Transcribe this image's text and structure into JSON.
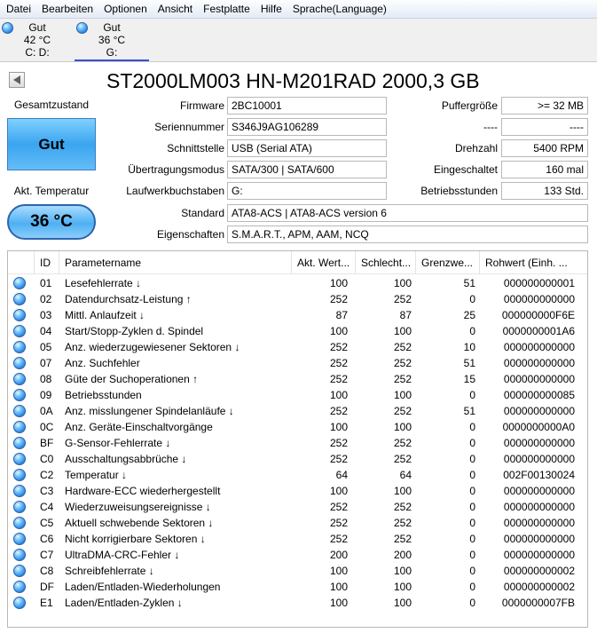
{
  "menu": [
    "Datei",
    "Bearbeiten",
    "Optionen",
    "Ansicht",
    "Festplatte",
    "Hilfe",
    "Sprache(Language)"
  ],
  "drives": [
    {
      "status": "Gut",
      "temp": "42 °C",
      "letters": "C: D:"
    },
    {
      "status": "Gut",
      "temp": "36 °C",
      "letters": "G:"
    }
  ],
  "title": "ST2000LM003 HN-M201RAD 2000,3 GB",
  "health": {
    "label": "Gesamtzustand",
    "value": "Gut"
  },
  "temperature": {
    "label": "Akt. Temperatur",
    "value": "36 °C"
  },
  "info": {
    "firmware_label": "Firmware",
    "firmware": "2BC10001",
    "serial_label": "Seriennummer",
    "serial": "S346J9AG106289",
    "interface_label": "Schnittstelle",
    "interface": "USB (Serial ATA)",
    "transfer_label": "Übertragungsmodus",
    "transfer": "SATA/300 | SATA/600",
    "letters_label": "Laufwerkbuchstaben",
    "letters": "G:",
    "standard_label": "Standard",
    "standard": "ATA8-ACS | ATA8-ACS version 6",
    "features_label": "Eigenschaften",
    "features": "S.M.A.R.T., APM, AAM, NCQ",
    "buffer_label": "Puffergröße",
    "buffer": ">= 32 MB",
    "blank_label": "----",
    "blank": "----",
    "rpm_label": "Drehzahl",
    "rpm": "5400 RPM",
    "power_count_label": "Eingeschaltet",
    "power_count": "160 mal",
    "hours_label": "Betriebsstunden",
    "hours": "133 Std."
  },
  "table": {
    "headers": [
      "ID",
      "Parametername",
      "Akt. Wert...",
      "Schlecht...",
      "Grenzwe...",
      "Rohwert (Einh. ..."
    ],
    "rows": [
      [
        "01",
        "Lesefehlerrate ↓",
        "100",
        "100",
        "51",
        "000000000001"
      ],
      [
        "02",
        "Datendurchsatz-Leistung ↑",
        "252",
        "252",
        "0",
        "000000000000"
      ],
      [
        "03",
        "Mittl. Anlaufzeit ↓",
        "87",
        "87",
        "25",
        "000000000F6E"
      ],
      [
        "04",
        "Start/Stopp-Zyklen d. Spindel",
        "100",
        "100",
        "0",
        "0000000001A6"
      ],
      [
        "05",
        "Anz. wiederzugewiesener Sektoren ↓",
        "252",
        "252",
        "10",
        "000000000000"
      ],
      [
        "07",
        "Anz. Suchfehler",
        "252",
        "252",
        "51",
        "000000000000"
      ],
      [
        "08",
        "Güte der Suchoperationen ↑",
        "252",
        "252",
        "15",
        "000000000000"
      ],
      [
        "09",
        "Betriebsstunden",
        "100",
        "100",
        "0",
        "000000000085"
      ],
      [
        "0A",
        "Anz. misslungener Spindelanläufe ↓",
        "252",
        "252",
        "51",
        "000000000000"
      ],
      [
        "0C",
        "Anz. Geräte-Einschaltvorgänge",
        "100",
        "100",
        "0",
        "0000000000A0"
      ],
      [
        "BF",
        "G-Sensor-Fehlerrate ↓",
        "252",
        "252",
        "0",
        "000000000000"
      ],
      [
        "C0",
        "Ausschaltungsabbrüche ↓",
        "252",
        "252",
        "0",
        "000000000000"
      ],
      [
        "C2",
        "Temperatur ↓",
        "64",
        "64",
        "0",
        "002F00130024"
      ],
      [
        "C3",
        "Hardware-ECC wiederhergestellt",
        "100",
        "100",
        "0",
        "000000000000"
      ],
      [
        "C4",
        "Wiederzuweisungsereignisse ↓",
        "252",
        "252",
        "0",
        "000000000000"
      ],
      [
        "C5",
        "Aktuell schwebende Sektoren ↓",
        "252",
        "252",
        "0",
        "000000000000"
      ],
      [
        "C6",
        "Nicht korrigierbare Sektoren ↓",
        "252",
        "252",
        "0",
        "000000000000"
      ],
      [
        "C7",
        "UltraDMA-CRC-Fehler ↓",
        "200",
        "200",
        "0",
        "000000000000"
      ],
      [
        "C8",
        "Schreibfehlerrate ↓",
        "100",
        "100",
        "0",
        "000000000002"
      ],
      [
        "DF",
        "Laden/Entladen-Wiederholungen",
        "100",
        "100",
        "0",
        "000000000002"
      ],
      [
        "E1",
        "Laden/Entladen-Zyklen ↓",
        "100",
        "100",
        "0",
        "0000000007FB"
      ]
    ]
  }
}
